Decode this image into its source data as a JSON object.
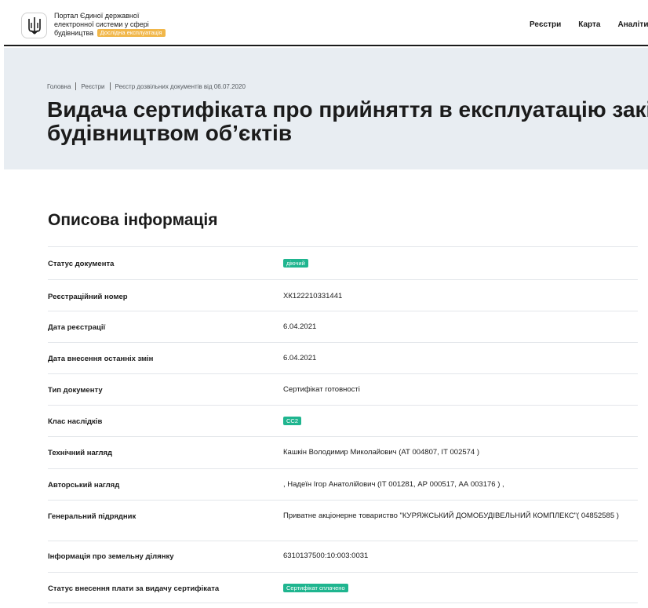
{
  "header": {
    "portal_title": "Портал Єдиної державної електронної системи у сфері будівництва",
    "portal_title_lines": [
      "Портал Єдиної державної",
      "електронної системи у сфері",
      "будівництва"
    ],
    "beta_badge": "Дослідна експлуатація",
    "nav": [
      "Реєстри",
      "Карта",
      "Аналітика"
    ]
  },
  "breadcrumb": {
    "home": "Головна",
    "registries": "Реєстри",
    "current": "Реєстр дозвільних документів від 06.07.2020"
  },
  "page_title_lines": [
    "Видача сертифіката про прийняття в експлуатацію закінчених",
    "будівництвом об’єктів"
  ],
  "section_title": "Описова інформація",
  "info_rows": [
    {
      "label": "Статус документа",
      "value": "діючий",
      "badge": true
    },
    {
      "label": "Реєстраційний номер",
      "value": "ХК122210331441",
      "badge": false
    },
    {
      "label": "Дата реєстрації",
      "value": "6.04.2021",
      "badge": false
    },
    {
      "label": "Дата внесення останніх змін",
      "value": "6.04.2021",
      "badge": false
    },
    {
      "label": "Тип документу",
      "value": "Сертифікат готовності",
      "badge": false
    },
    {
      "label": "Клас наслідків",
      "value": "СС2",
      "badge": true
    },
    {
      "label": "Технічний нагляд",
      "value": "Кашкін Володимир Миколайович (АТ 004807, ІТ 002574 )",
      "badge": false
    },
    {
      "label": "Авторський нагляд",
      "value": ", Надеїн Ігор Анатолійович (ІТ 001281, АР 000517, АА 003176 ) ,",
      "badge": false
    },
    {
      "label": "Генеральний підрядник",
      "value": "Приватне акціонерне товариство \"КУРЯЖСЬКИЙ ДОМОБУДІВЕЛЬНИЙ КОМПЛЕКС\"( 04852585 )",
      "badge": false
    },
    {
      "label": "Інформація про земельну ділянку",
      "value": "6310137500:10:003:0031",
      "badge": false
    },
    {
      "label": "Статус внесення плати за видачу сертифіката",
      "value": "Сертифікат сплачено",
      "badge": true
    }
  ],
  "colors": {
    "hero_bg": "#e8edf2",
    "badge_green": "#1fb58f",
    "beta_orange": "#f1b74a",
    "text": "#1b1b1b"
  },
  "icons": {
    "emblem": "ukraine-trident-icon"
  }
}
